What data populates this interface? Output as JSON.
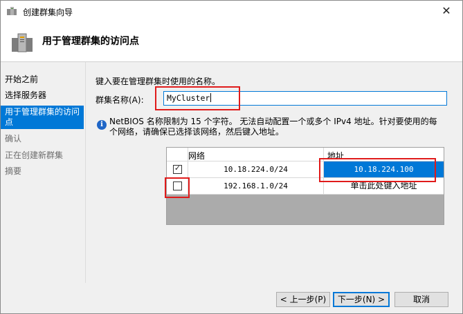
{
  "window": {
    "title": "创建群集向导",
    "close_glyph": "✕"
  },
  "header": {
    "title": "用于管理群集的访问点"
  },
  "nav": {
    "items": [
      {
        "label": "开始之前",
        "state": "normal"
      },
      {
        "label": "选择服务器",
        "state": "normal"
      },
      {
        "label": "用于管理群集的访问点",
        "state": "active"
      },
      {
        "label": "确认",
        "state": "disabled"
      },
      {
        "label": "正在创建新群集",
        "state": "disabled"
      },
      {
        "label": "摘要",
        "state": "disabled"
      }
    ]
  },
  "content": {
    "instruction": "键入要在管理群集时使用的名称。",
    "cluster_name_label": "群集名称(A):",
    "cluster_name_value": "MyCluster",
    "info_text": "NetBIOS 名称限制为 15 个字符。 无法自动配置一个或多个 IPv4 地址。针对要使用的每个网络，请确保已选择该网络，然后键入地址。"
  },
  "grid": {
    "columns": [
      "网络",
      "地址"
    ],
    "rows": [
      {
        "checked": true,
        "network": "10.18.224.0/24",
        "address": "10.18.224.100",
        "address_selected": true
      },
      {
        "checked": false,
        "network": "192.168.1.0/24",
        "address": "单击此处键入地址",
        "address_selected": false
      }
    ]
  },
  "footer": {
    "back_label": "< 上一步(P)",
    "next_label": "下一步(N) >",
    "cancel_label": "取消"
  },
  "colors": {
    "accent": "#0078d7",
    "highlight": "#e01a1a"
  }
}
